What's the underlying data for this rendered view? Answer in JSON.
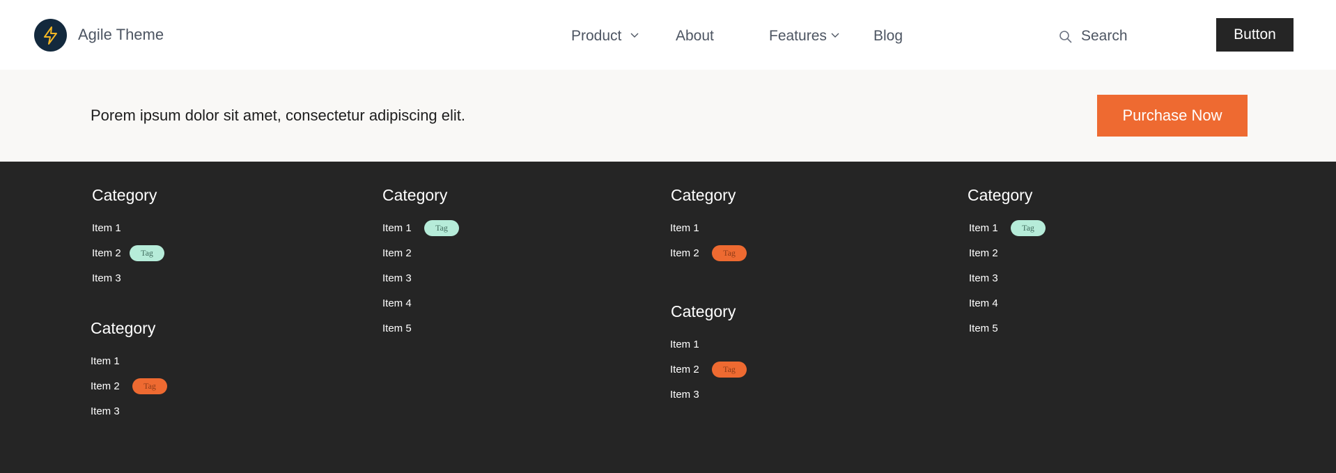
{
  "header": {
    "brand": "Agile Theme",
    "nav": [
      "Product",
      "About",
      "Features",
      "Blog"
    ],
    "search_label": "Search",
    "button_label": "Button"
  },
  "promo": {
    "text": "Porem ipsum dolor sit amet, consectetur adipiscing elit.",
    "button_label": "Purchase Now"
  },
  "footer": {
    "col1": {
      "a": {
        "title": "Category",
        "items": [
          "Item 1",
          "Item 2",
          "Item 3"
        ],
        "tag": "Tag"
      },
      "b": {
        "title": "Category",
        "items": [
          "Item 1",
          "Item 2",
          "Item 3"
        ],
        "tag": "Tag"
      }
    },
    "col2": {
      "title": "Category",
      "items": [
        "Item 1",
        "Item 2",
        "Item 3",
        "Item 4",
        "Item 5"
      ],
      "tag": "Tag"
    },
    "col3": {
      "a": {
        "title": "Category",
        "items": [
          "Item 1",
          "Item 2"
        ],
        "tag": "Tag"
      },
      "b": {
        "title": "Category",
        "items": [
          "Item 1",
          "Item 2",
          "Item 3"
        ],
        "tag": "Tag"
      }
    },
    "col4": {
      "title": "Category",
      "items": [
        "Item 1",
        "Item 2",
        "Item 3",
        "Item 4",
        "Item 5"
      ],
      "tag": "Tag"
    }
  },
  "colors": {
    "accent": "#ee6a31",
    "tag_mint": "#b6ecd9",
    "dark": "#252525",
    "logo_bg": "#13293d",
    "logo_bolt": "#f4b724"
  },
  "icons": [
    "lightning-bolt-icon",
    "chevron-down-icon",
    "search-icon"
  ]
}
